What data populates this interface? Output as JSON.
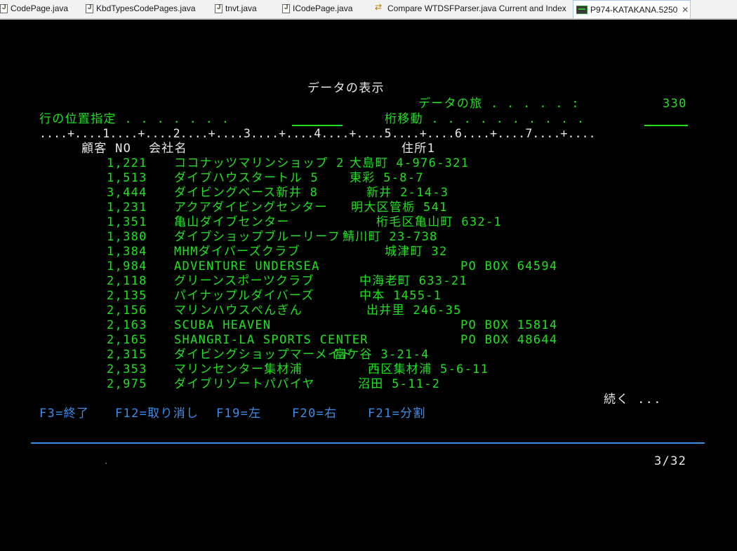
{
  "tabs": [
    {
      "label": "CodePage.java",
      "icon": "java-file-icon"
    },
    {
      "label": "KbdTypesCodePages.java",
      "icon": "java-file-icon"
    },
    {
      "label": "tnvt.java",
      "icon": "java-file-icon"
    },
    {
      "label": "ICodePage.java",
      "icon": "java-file-icon"
    },
    {
      "label": "Compare WTDSFParser.java Current and Index",
      "icon": "compare-icon"
    },
    {
      "label": "P974-KATAKANA.5250",
      "icon": "terminal-icon",
      "active": true
    }
  ],
  "screen": {
    "title": "データの表示",
    "record_label": "データの旅 . . . . . :",
    "record_value": "330",
    "position_label": "行の位置指定 . . . . . . .",
    "width_label": "桁移動 . . . . . . . . . .",
    "ruler": "....+....1....+....2....+....3....+....4....+....5....+....6....+....7....+....",
    "headers": {
      "customer_no": "顧客 NO",
      "company": "会社名",
      "address": "住所1"
    },
    "rows": [
      {
        "no": "1,221",
        "company": "ココナッツマリンショップ 2",
        "address": "大島町 4-976-321"
      },
      {
        "no": "1,513",
        "company": "ダイブハウスタートル 5",
        "address": "東彩 5-8-7"
      },
      {
        "no": "3,444",
        "company": "ダイビングベース新井 8",
        "address": "新井 2-14-3"
      },
      {
        "no": "1,231",
        "company": "アクアダイビングセンター",
        "address": "明大区管栃 541"
      },
      {
        "no": "1,351",
        "company": "亀山ダイブセンター",
        "address": "桁毛区亀山町 632-1"
      },
      {
        "no": "1,380",
        "company": "ダイブショップブルーリーフ",
        "address": "鯖川町 23-738"
      },
      {
        "no": "1,384",
        "company": "MHMダイバーズクラブ",
        "address": "城津町 32"
      },
      {
        "no": "1,984",
        "company": "ADVENTURE UNDERSEA",
        "address": "PO BOX 64594"
      },
      {
        "no": "2,118",
        "company": "グリーンスポーツクラブ",
        "address": "中海老町 633-21"
      },
      {
        "no": "2,135",
        "company": "パイナップルダイバーズ",
        "address": "中本 1455-1"
      },
      {
        "no": "2,156",
        "company": "マリンハウスぺんぎん",
        "address": "出井里 246-35"
      },
      {
        "no": "2,163",
        "company": "SCUBA HEAVEN",
        "address": "PO BOX 15814"
      },
      {
        "no": "2,165",
        "company": "SHANGRI-LA SPORTS CENTER",
        "address": "PO BOX 48644"
      },
      {
        "no": "2,315",
        "company": "ダイビングショップマーメイド",
        "address": "富ケ谷 3-21-4"
      },
      {
        "no": "2,353",
        "company": "マリンセンター集材浦",
        "address": "西区集材浦 5-6-11"
      },
      {
        "no": "2,975",
        "company": "ダイブリゾートパパイヤ",
        "address": "沼田 5-11-2"
      }
    ],
    "more": "続く ...",
    "fkeys": [
      "F3=終了",
      "F12=取り消し",
      "F19=左",
      "F20=右",
      "F21=分割"
    ],
    "page_indicator": "3/32"
  },
  "colors": {
    "green": "#20e020",
    "white": "#e8e8e8",
    "blue": "#3b8ee8",
    "background": "#000000"
  }
}
